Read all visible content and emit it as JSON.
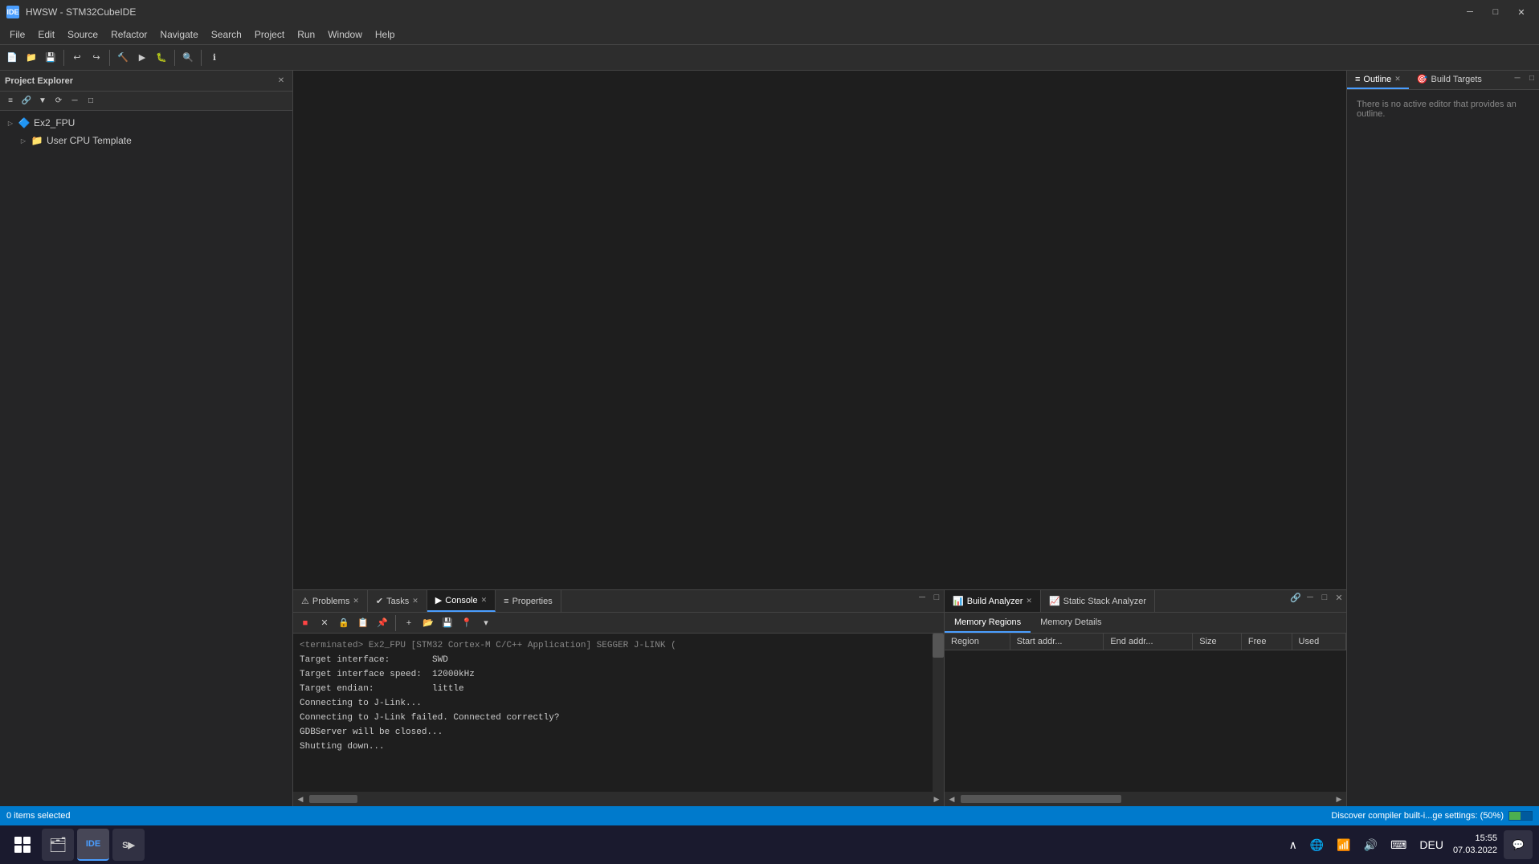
{
  "titlebar": {
    "icon_label": "IDE",
    "title": "HWSW - STM32CubeIDE",
    "minimize_label": "─",
    "maximize_label": "□",
    "close_label": "✕"
  },
  "menubar": {
    "items": [
      "File",
      "Edit",
      "Source",
      "Refactor",
      "Navigate",
      "Search",
      "Project",
      "Run",
      "Window",
      "Help"
    ]
  },
  "left_panel": {
    "title": "Project Explorer",
    "tree": [
      {
        "label": "Ex2_FPU",
        "type": "project",
        "expanded": false,
        "indent": 0
      },
      {
        "label": "User CPU Template",
        "type": "folder",
        "expanded": false,
        "indent": 1
      }
    ]
  },
  "right_panel": {
    "tabs": [
      "Outline",
      "Build Targets"
    ],
    "outline_text": "There is no active editor that provides an outline."
  },
  "console_panel": {
    "tabs": [
      "Problems",
      "Tasks",
      "Console",
      "Properties"
    ],
    "active_tab": "Console",
    "terminated_text": "<terminated> Ex2_FPU [STM32 Cortex-M C/C++ Application] SEGGER J-LINK (",
    "lines": [
      "Target interface:        SWD",
      "Target interface speed:  12000kHz",
      "Target endian:           little",
      "",
      "Connecting to J-Link...",
      "Connecting to J-Link failed. Connected correctly?",
      "GDBServer will be closed...",
      "Shutting down..."
    ]
  },
  "build_analyzer": {
    "tabs": [
      "Build Analyzer",
      "Static Stack Analyzer"
    ],
    "active_tab": "Build Analyzer",
    "memory_tabs": [
      "Memory Regions",
      "Memory Details"
    ],
    "active_memory_tab": "Memory Regions",
    "table_headers": [
      "Region",
      "Start addr...",
      "End addr...",
      "Size",
      "Free",
      "Used"
    ],
    "table_rows": []
  },
  "status_bar": {
    "left_text": "0 items selected",
    "progress_text": "Discover compiler built-i...ge settings: (50%)",
    "progress_value": 50
  },
  "taskbar": {
    "apps": [
      {
        "label": "⊞",
        "name": "start-button",
        "active": false
      },
      {
        "label": "🗂",
        "name": "file-explorer",
        "active": false
      },
      {
        "label": "IDE",
        "name": "stm32cubeide",
        "active": true
      },
      {
        "label": "S▶",
        "name": "segger",
        "active": false
      }
    ],
    "system_tray": {
      "time": "15:55",
      "date": "07.03.2022"
    }
  }
}
